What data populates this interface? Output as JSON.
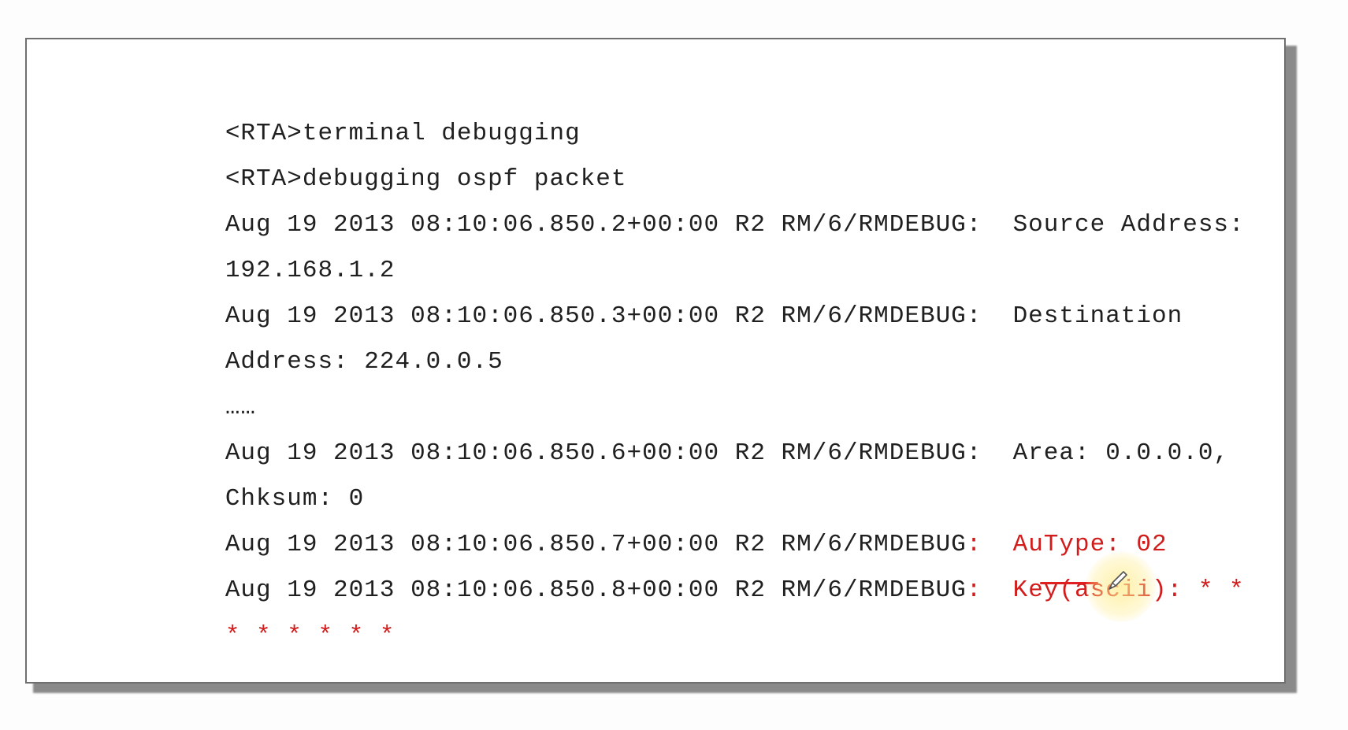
{
  "terminal": {
    "lines": [
      {
        "text": "<RTA>terminal debugging"
      },
      {
        "text": "<RTA>debugging ospf packet"
      },
      {
        "text": "Aug 19 2013 08:10:06.850.2+00:00 R2 RM/6/RMDEBUG:  Source Address:"
      },
      {
        "text": "192.168.1.2"
      },
      {
        "text": "Aug 19 2013 08:10:06.850.3+00:00 R2 RM/6/RMDEBUG:  Destination"
      },
      {
        "text": "Address: 224.0.0.5"
      },
      {
        "text": "……"
      },
      {
        "text": "Aug 19 2013 08:10:06.850.6+00:00 R2 RM/6/RMDEBUG:  Area: 0.0.0.0,"
      },
      {
        "text": "Chksum: 0"
      },
      {
        "prefix": "Aug 19 2013 08:10:06.850.7+00:00 R2 RM/6/RMDEBUG",
        "highlight": ":  AuType: 02"
      },
      {
        "prefix": "Aug 19 2013 08:10:06.850.8+00:00 R2 RM/6/RMDEBUG",
        "highlight": ":  Key(ascii): * *"
      },
      {
        "highlight": "* * * * * *"
      }
    ]
  },
  "colors": {
    "text": "#202020",
    "highlight": "#d21c1c",
    "border": "#6f6f6f",
    "cursor_halo": "#ffec8c"
  },
  "icons": {
    "cursor": "pen-cursor-icon"
  }
}
